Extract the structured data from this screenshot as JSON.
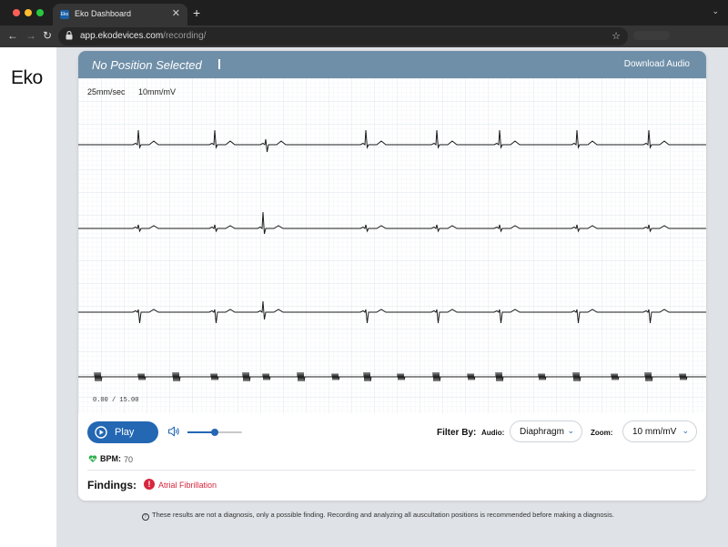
{
  "browser": {
    "tab_title": "Eko Dashboard",
    "favicon_text": "Eko",
    "tab_close": "✕",
    "new_tab": "+",
    "url_host": "app.ekodevices.com",
    "url_path": "/recording/",
    "nav": {
      "back": "←",
      "forward": "→",
      "reload": "↻"
    },
    "star": "☆",
    "window_menu": "⌄"
  },
  "sidebar": {
    "brand": "Eko"
  },
  "recording": {
    "position_title": "No Position Selected",
    "download_label": "Download Audio",
    "paper_speed": "25mm/sec",
    "gain": "10mm/mV",
    "time_readout": "0.00 / 15.00"
  },
  "player": {
    "play_label": "Play",
    "volume_level": 0.5
  },
  "filters": {
    "filter_by_label": "Filter By:",
    "audio_label": "Audio:",
    "audio_value": "Diaphragm",
    "zoom_label": "Zoom:",
    "zoom_value": "10 mm/mV",
    "chevron": "⌄"
  },
  "vitals": {
    "bpm_label": "BPM:",
    "bpm_value": "70"
  },
  "findings": {
    "label": "Findings:",
    "icon": "!",
    "items": [
      "Atrial Fibrillation"
    ]
  },
  "disclaimer": {
    "icon": "!",
    "text": "These results are not a diagnosis, only a possible finding. Recording and analyzing all auscultation positions is recommended before making a diagnosis."
  },
  "colors": {
    "header": "#6f8fa8",
    "accent": "#2467b3",
    "alert": "#d7263d",
    "heart": "#2fae4f"
  }
}
